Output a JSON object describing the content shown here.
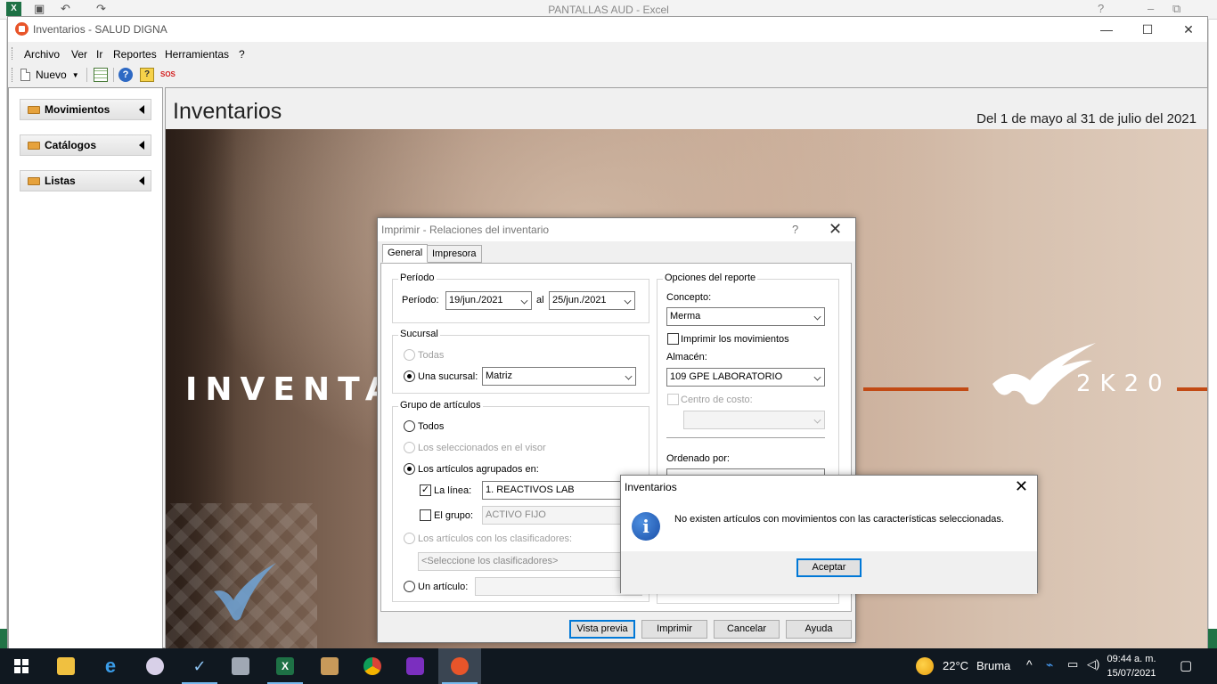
{
  "excel": {
    "title": "PANTALLAS AUD - Excel",
    "logo": "X",
    "ctrl_help": "?",
    "ctrl_min": "–",
    "ctrl_restore": "⧉"
  },
  "app": {
    "title": "Inventarios - SALUD DIGNA",
    "menu": [
      "Archivo",
      "Ver",
      "Ir",
      "Reportes",
      "Herramientas",
      "?"
    ],
    "toolbar": {
      "new_label": "Nuevo",
      "sos_label": "SOS"
    }
  },
  "sidebar": {
    "items": [
      {
        "label": "Movimientos"
      },
      {
        "label": "Catálogos"
      },
      {
        "label": "Listas"
      }
    ]
  },
  "content": {
    "title": "Inventarios",
    "date_range": "Del 1 de mayo al 31 de julio del 2021",
    "banner_word": "INVENTARIO",
    "banner_year": "2K20",
    "accent_color": "#c24a14"
  },
  "print_dialog": {
    "title": "Imprimir - Relaciones del inventario",
    "help": "?",
    "close": "✕",
    "tabs": [
      "General",
      "Impresora"
    ],
    "periodo": {
      "group": "Período",
      "label": "Período:",
      "from": "19/jun./2021",
      "sep": "al",
      "to": "25/jun./2021"
    },
    "sucursal": {
      "group": "Sucursal",
      "todas": "Todas",
      "una": "Una sucursal:",
      "value": "Matriz"
    },
    "grupo": {
      "group": "Grupo de artículos",
      "todos": "Todos",
      "seleccionados": "Los seleccionados en el visor",
      "agrupados": "Los artículos agrupados en:",
      "linea_label": "La línea:",
      "linea_value": "1. REACTIVOS LAB",
      "grupo_label": "El grupo:",
      "grupo_value": "ACTIVO FIJO",
      "clasificadores": "Los artículos con los clasificadores:",
      "clasificadores_value": "<Seleccione los clasificadores>",
      "articulo": "Un artículo:"
    },
    "opciones": {
      "group": "Opciones del reporte",
      "concepto_label": "Concepto:",
      "concepto_value": "Merma",
      "imprimir_mov": "Imprimir los movimientos",
      "almacen_label": "Almacén:",
      "almacen_value": "109 GPE LABORATORIO",
      "centro_label": "Centro de costo:",
      "ordenado_label": "Ordenado por:"
    },
    "buttons": [
      "Vista previa",
      "Imprimir",
      "Cancelar",
      "Ayuda"
    ]
  },
  "message_box": {
    "title": "Inventarios",
    "close": "✕",
    "icon": "info-icon",
    "text": "No existen artículos con movimientos con las características seleccionadas.",
    "ok": "Aceptar"
  },
  "taskbar": {
    "weather_temp": "22°C",
    "weather_text": "Bruma",
    "time": "09:44 a. m.",
    "date": "15/07/2021",
    "apps": [
      "windows-start",
      "file-explorer",
      "internet-explorer",
      "app-paint",
      "salud-digna-app",
      "calculator",
      "excel",
      "box-2020",
      "chrome",
      "shop-app",
      "inventarios-app"
    ]
  }
}
